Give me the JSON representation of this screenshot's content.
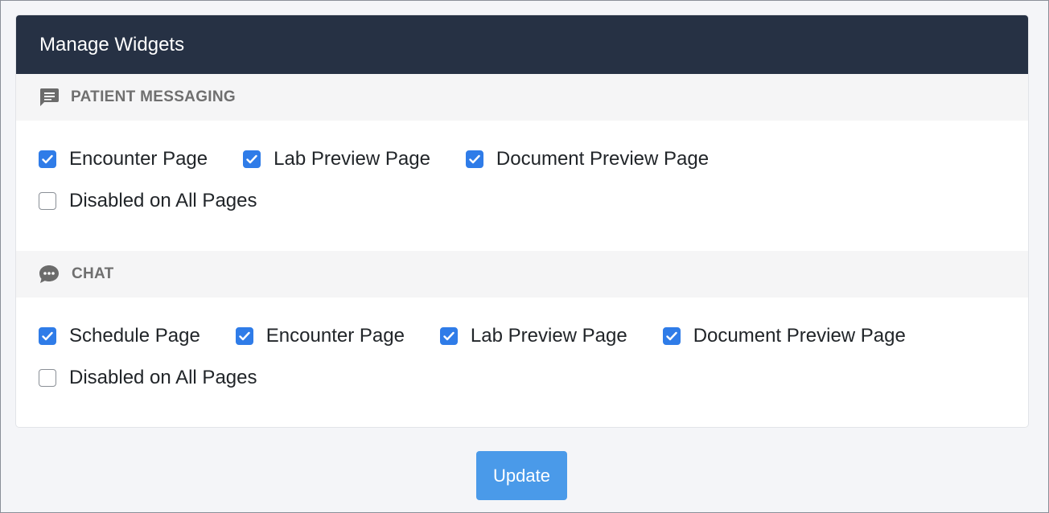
{
  "header": {
    "title": "Manage Widgets"
  },
  "sections": [
    {
      "title": "PATIENT MESSAGING",
      "icon": "message-icon",
      "options": [
        {
          "label": "Encounter Page",
          "checked": true
        },
        {
          "label": "Lab Preview Page",
          "checked": true
        },
        {
          "label": "Document Preview Page",
          "checked": true
        },
        {
          "label": "Disabled on All Pages",
          "checked": false
        }
      ]
    },
    {
      "title": "CHAT",
      "icon": "chat-icon",
      "options": [
        {
          "label": "Schedule Page",
          "checked": true
        },
        {
          "label": "Encounter Page",
          "checked": true
        },
        {
          "label": "Lab Preview Page",
          "checked": true
        },
        {
          "label": "Document Preview Page",
          "checked": true
        },
        {
          "label": "Disabled on All Pages",
          "checked": false
        }
      ]
    }
  ],
  "actions": {
    "update_label": "Update"
  },
  "colors": {
    "header_bg": "#263144",
    "checkbox_checked": "#2f7ce8",
    "update_button": "#4a9ae9"
  }
}
